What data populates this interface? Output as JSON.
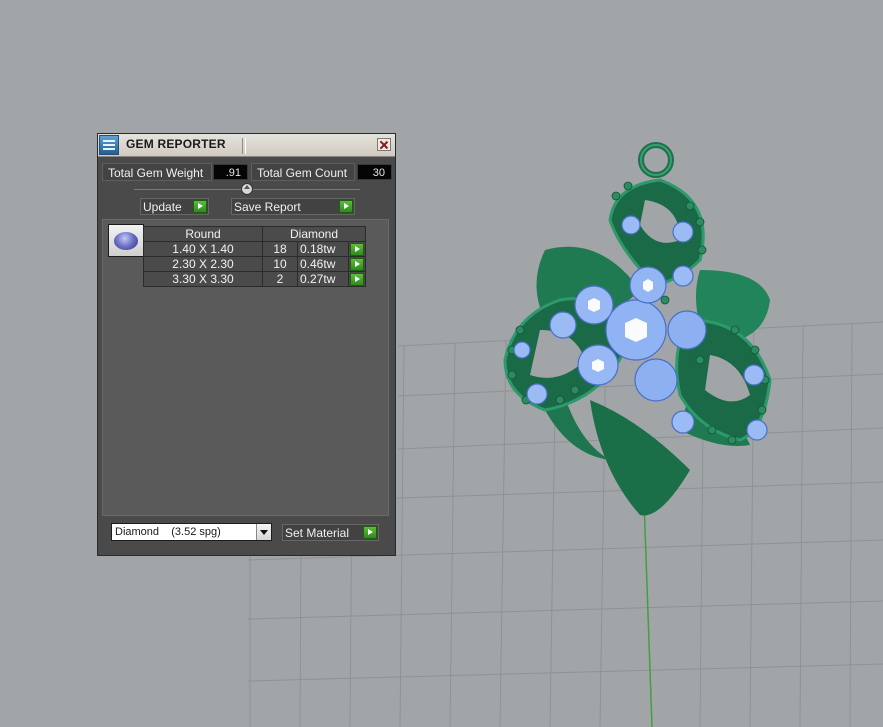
{
  "window": {
    "title": "GEM REPORTER",
    "icons": {
      "app": "gem-reporter-app-icon",
      "close": "close-icon"
    }
  },
  "summary": {
    "total_weight_label": "Total Gem Weight",
    "total_weight_value": ".91",
    "total_count_label": "Total Gem Count",
    "total_count_value": "30"
  },
  "actions": {
    "update_label": "Update",
    "save_report_label": "Save Report"
  },
  "gem_table": {
    "thumbnail_icon": "round-diamond-icon",
    "headers": [
      "Round",
      "Diamond"
    ],
    "rows": [
      {
        "size": "1.40 X 1.40",
        "count": "18",
        "weight": "0.18tw"
      },
      {
        "size": "2.30 X 2.30",
        "count": "10",
        "weight": "0.46tw"
      },
      {
        "size": "3.30 X 3.30",
        "count": "2",
        "weight": "0.27tw"
      }
    ]
  },
  "material": {
    "selected": "Diamond    (3.52 spg)",
    "set_material_label": "Set Material"
  },
  "colors": {
    "panel_bg": "#4a4a4a",
    "play_green": "#3a9a24",
    "metal_green": "#1f7a52",
    "gem_blue": "#8ab0f2",
    "viewport_bg": "#a2a5a8",
    "axis_green": "#3fa03f"
  }
}
